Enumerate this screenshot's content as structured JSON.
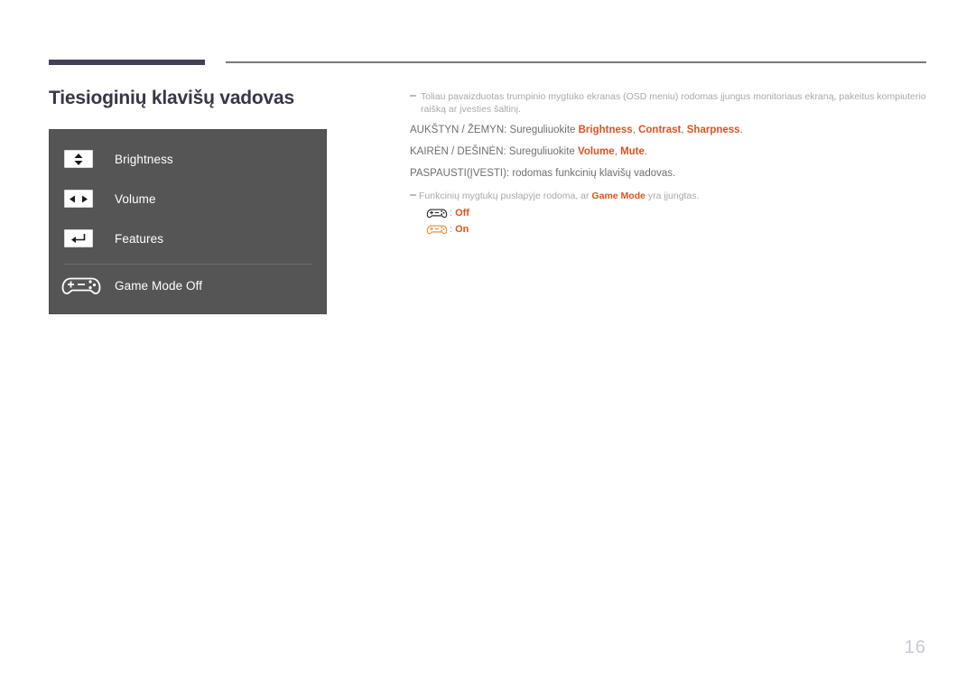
{
  "page": {
    "title": "Tiesioginių klavišų vadovas",
    "number": "16",
    "accent_color": "#e0521f",
    "title_color": "#3a3547",
    "rule_color": "#453f55",
    "panel_bg": "#555555"
  },
  "osd_panel": {
    "rows": [
      {
        "icon": "up-down-arrows-icon",
        "label": "Brightness"
      },
      {
        "icon": "left-right-arrows-icon",
        "label": "Volume"
      },
      {
        "icon": "enter-key-icon",
        "label": "Features"
      },
      {
        "icon": "gamepad-icon",
        "label": "Game Mode Off"
      }
    ]
  },
  "notes": {
    "intro": "Toliau pavaizduotas trumpinio mygtuko ekranas (OSD meniu) rodomas įjungus monitoriaus ekraną, pakeitus kompiuterio raišką ar įvesties šaltinį.",
    "gamemode_note_before": "Funkcinių mygtukų puslapyje rodoma, ar ",
    "gamemode_note_accent": "Game Mode",
    "gamemode_note_after": " yra įjungtas."
  },
  "instructions": [
    {
      "prefix": "AUKŠTYN / ŽEMYN: Sureguliuokite ",
      "accents": [
        "Brightness",
        "Contrast",
        "Sharpness"
      ],
      "separator": ", ",
      "suffix": "."
    },
    {
      "prefix": "KAIRĖN / DEŠINĖN: Sureguliuokite ",
      "accents": [
        "Volume",
        "Mute"
      ],
      "separator": ", ",
      "suffix": "."
    },
    {
      "prefix": "PASPAUSTI(ĮVESTI): rodomas funkcinių klavišų vadovas.",
      "accents": [],
      "separator": "",
      "suffix": ""
    }
  ],
  "game_mode_states": [
    {
      "icon": "gamepad-off-icon",
      "colon": ":",
      "label": "Off",
      "color": "#2b2b2b"
    },
    {
      "icon": "gamepad-on-icon",
      "colon": ":",
      "label": "On",
      "color": "#e8923a"
    }
  ]
}
